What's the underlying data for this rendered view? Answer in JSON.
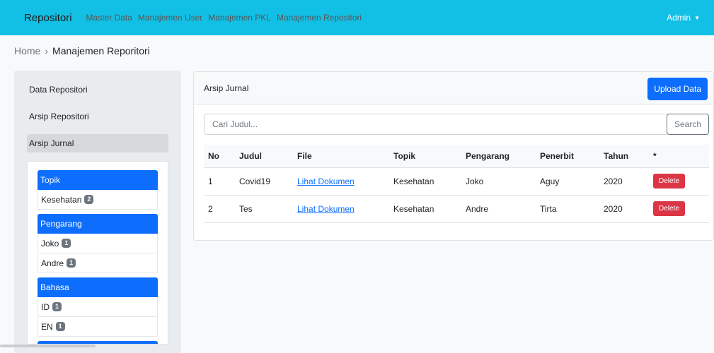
{
  "navbar": {
    "brand": "Repositori",
    "links": [
      "Master Data",
      "Manajemen User",
      "Manajemen PKL",
      "Manajemen Repositori"
    ],
    "user": "Admin"
  },
  "breadcrumb": {
    "home": "Home",
    "separator": "›",
    "current": "Manajemen Reporitori"
  },
  "sidebar": {
    "items": [
      "Data Repositori",
      "Arsip Repositori",
      "Arsip Jurnal"
    ],
    "active_index": 2,
    "filters": [
      {
        "title": "Topik",
        "items": [
          {
            "label": "Kesehatan",
            "count": "2"
          }
        ]
      },
      {
        "title": "Pengarang",
        "items": [
          {
            "label": "Joko",
            "count": "1"
          },
          {
            "label": "Andre",
            "count": "1"
          }
        ]
      },
      {
        "title": "Bahasa",
        "items": [
          {
            "label": "ID",
            "count": "1"
          },
          {
            "label": "EN",
            "count": "1"
          }
        ]
      }
    ]
  },
  "card": {
    "title": "Arsip Jurnal",
    "upload_label": "Upload Data",
    "search_placeholder": "Cari Judul...",
    "search_label": "Search"
  },
  "table": {
    "headers": [
      "No",
      "Judul",
      "File",
      "Topik",
      "Pengarang",
      "Penerbit",
      "Tahun",
      "*"
    ],
    "rows": [
      {
        "no": "1",
        "judul": "Covid19",
        "file": "Lihat Dokumen",
        "topik": "Kesehatan",
        "pengarang": "Joko",
        "penerbit": "Aguy",
        "tahun": "2020",
        "action": "Delete"
      },
      {
        "no": "2",
        "judul": "Tes",
        "file": "Lihat Dokumen",
        "topik": "Kesehatan",
        "pengarang": "Andre",
        "penerbit": "Tirta",
        "tahun": "2020",
        "action": "Delete"
      }
    ]
  },
  "colors": {
    "navbar": "#12c0e6",
    "primary": "#0d6efd",
    "danger": "#dc3545"
  }
}
